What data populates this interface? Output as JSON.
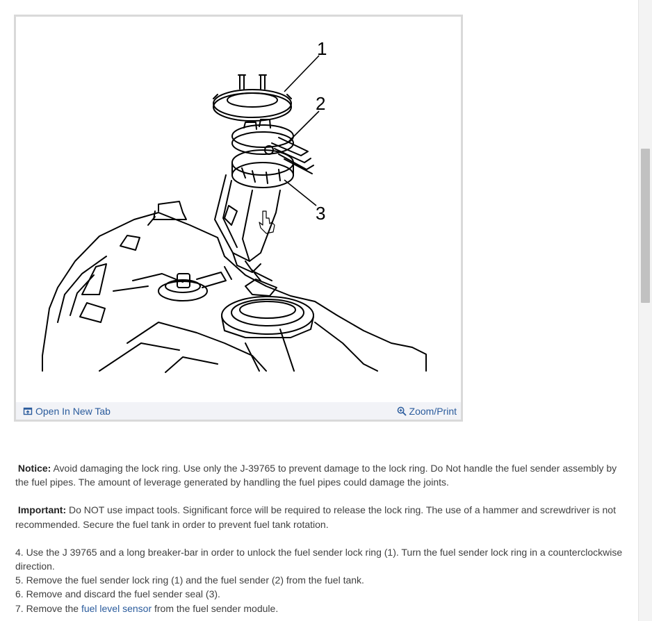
{
  "figure": {
    "callouts": [
      "1",
      "2",
      "3"
    ],
    "open_label": "Open In New Tab",
    "open_icon": "open-in-new-tab-icon",
    "zoom_label": "Zoom/Print",
    "zoom_icon": "zoom-icon",
    "link_color": "#2a5b9c"
  },
  "content": {
    "notice_label": "Notice:",
    "notice_text": " Avoid damaging the lock ring. Use only the J-39765 to prevent damage to the lock ring. Do Not handle the fuel sender assembly by the fuel pipes. The amount of leverage generated by handling the fuel pipes could damage the joints.",
    "important_label": "Important:",
    "important_text": " Do NOT use impact tools. Significant force will be required to release the lock ring. The use of a hammer and screwdriver is not recommended. Secure the fuel tank in order to prevent fuel tank rotation.",
    "steps": [
      " 4. Use the J 39765 and a long breaker-bar in order to unlock the fuel sender lock ring (1). Turn the fuel sender lock ring in a counterclockwise direction.",
      " 5. Remove the fuel sender lock ring (1) and the fuel sender (2) from the fuel tank.",
      " 6. Remove and discard the fuel sender seal (3)."
    ],
    "step7_prefix": " 7. Remove the ",
    "step7_link": "fuel level sensor",
    "step7_suffix": " from the fuel sender module."
  }
}
